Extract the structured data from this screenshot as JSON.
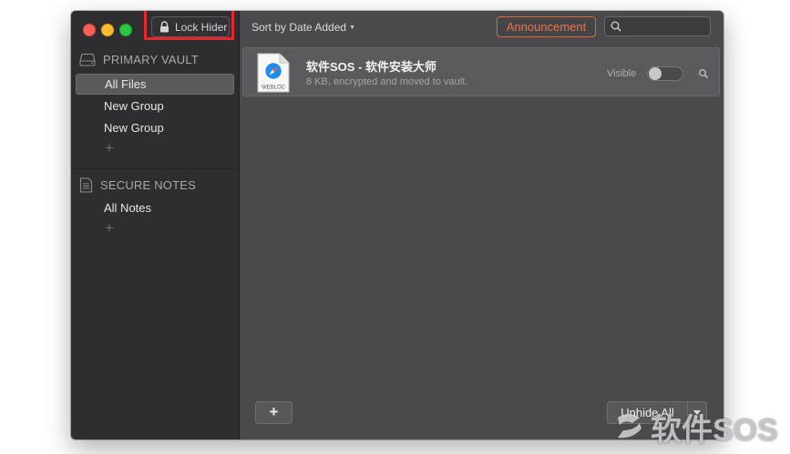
{
  "toolbar": {
    "lock_label": "Lock Hider",
    "sort_label": "Sort by Date Added",
    "announcement_label": "Announcement",
    "search_placeholder": ""
  },
  "sidebar": {
    "vault_header": "PRIMARY VAULT",
    "vault_items": [
      {
        "label": "All Files",
        "selected": true
      },
      {
        "label": "New Group",
        "selected": false
      },
      {
        "label": "New Group",
        "selected": false
      }
    ],
    "notes_header": "SECURE NOTES",
    "notes_items": [
      {
        "label": "All Notes",
        "selected": false
      }
    ]
  },
  "files": [
    {
      "name": "软件SOS - 软件安装大师",
      "details": "8 KB, encrypted and moved to vault.",
      "icon": "webloc-file-icon",
      "icon_text": "WEBLOC",
      "visible_label": "Visible",
      "visible": false
    }
  ],
  "footer": {
    "add_label": "+",
    "unhide_label": "Unhide All"
  },
  "watermark": {
    "text": "软件SOS"
  },
  "colors": {
    "highlight_red": "#e8262c",
    "announcement_orange": "#f0714a",
    "sidebar_bg": "#2e2e30",
    "main_bg": "#4a4a4d"
  }
}
